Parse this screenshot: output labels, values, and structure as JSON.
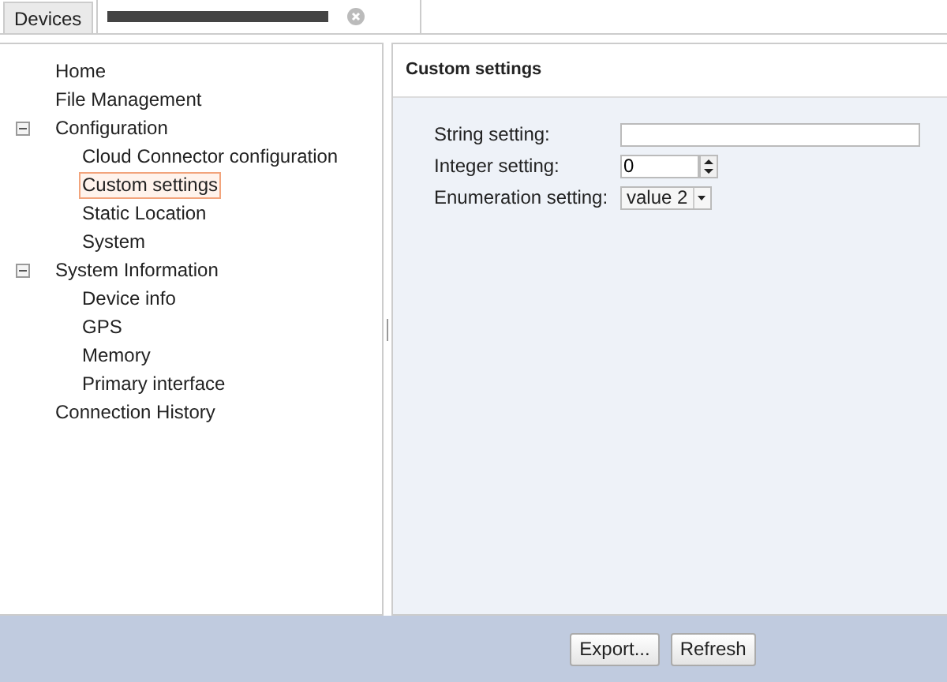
{
  "tabs": [
    {
      "kind": "text",
      "label": "Devices",
      "selected": false
    },
    {
      "kind": "redacted",
      "selected": true
    }
  ],
  "tree": [
    {
      "label": "Home",
      "selected": false
    },
    {
      "label": "File Management",
      "selected": false
    },
    {
      "label": "Configuration",
      "selected": false,
      "expanded": true,
      "children": [
        {
          "label": "Cloud Connector configuration",
          "selected": false
        },
        {
          "label": "Custom settings",
          "selected": true
        },
        {
          "label": "Static Location",
          "selected": false
        },
        {
          "label": "System",
          "selected": false
        }
      ]
    },
    {
      "label": "System Information",
      "selected": false,
      "expanded": true,
      "children": [
        {
          "label": "Device info",
          "selected": false
        },
        {
          "label": "GPS",
          "selected": false
        },
        {
          "label": "Memory",
          "selected": false
        },
        {
          "label": "Primary interface",
          "selected": false
        }
      ]
    },
    {
      "label": "Connection History",
      "selected": false
    }
  ],
  "panel": {
    "title": "Custom settings",
    "fields": [
      {
        "kind": "text",
        "label": "String setting:"
      },
      {
        "kind": "spinner",
        "label": "Integer setting:",
        "value": "0"
      },
      {
        "kind": "select",
        "label": "Enumeration setting:",
        "value": "value 2"
      }
    ]
  },
  "buttons": [
    "Export...",
    "Refresh"
  ]
}
